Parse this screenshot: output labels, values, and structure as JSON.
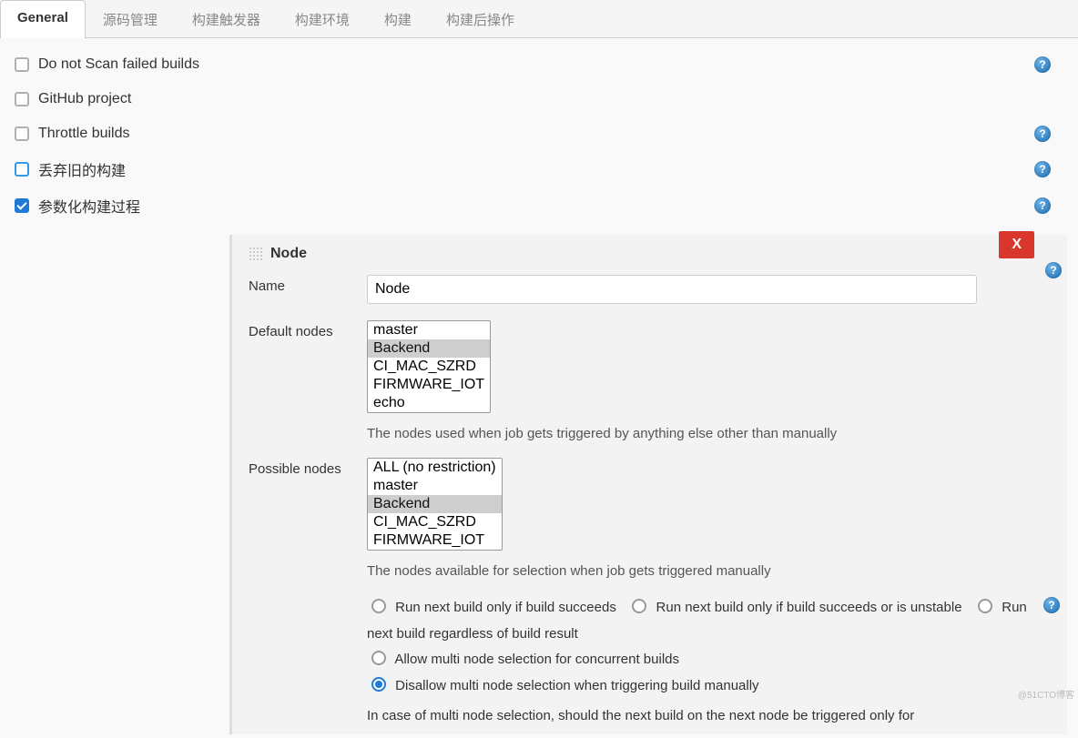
{
  "tabs": {
    "items": [
      {
        "label": "General",
        "active": true
      },
      {
        "label": "源码管理"
      },
      {
        "label": "构建触发器"
      },
      {
        "label": "构建环境"
      },
      {
        "label": "构建"
      },
      {
        "label": "构建后操作"
      }
    ]
  },
  "general_options": [
    {
      "label": "Do not Scan failed builds",
      "checked": false,
      "help": true
    },
    {
      "label": "GitHub project",
      "checked": false,
      "help": false
    },
    {
      "label": "Throttle builds",
      "checked": false,
      "help": true
    },
    {
      "label": "丢弃旧的构建",
      "checked": false,
      "help": true,
      "outline": true
    },
    {
      "label": "参数化构建过程",
      "checked": true,
      "help": true
    }
  ],
  "node_block": {
    "title": "Node",
    "delete_label": "X",
    "name_label": "Name",
    "name_value": "Node",
    "default_nodes_label": "Default nodes",
    "default_nodes": [
      "master",
      "Backend",
      "CI_MAC_SZRD",
      "FIRMWARE_IOT",
      "echo"
    ],
    "default_nodes_selected": [
      "Backend"
    ],
    "default_nodes_desc": "The nodes used when job gets triggered by anything else other than manually",
    "possible_nodes_label": "Possible nodes",
    "possible_nodes": [
      "ALL (no restriction)",
      "master",
      "Backend",
      "CI_MAC_SZRD",
      "FIRMWARE_IOT"
    ],
    "possible_nodes_selected": [
      "Backend"
    ],
    "possible_nodes_desc": "The nodes available for selection when job gets triggered manually",
    "radios_group1": [
      {
        "label": "Run next build only if build succeeds",
        "checked": false
      },
      {
        "label": "Run next build only if build succeeds or is unstable",
        "checked": false
      },
      {
        "label": "Run next build regardless of build result",
        "checked": false
      }
    ],
    "radios_group2": [
      {
        "label": "Allow multi node selection for concurrent builds",
        "checked": false
      },
      {
        "label": "Disallow multi node selection when triggering build manually",
        "checked": true
      }
    ],
    "bottom_text": "In case of multi node selection, should the next build on the next node be triggered only for"
  },
  "watermark": "@51CTO博客"
}
